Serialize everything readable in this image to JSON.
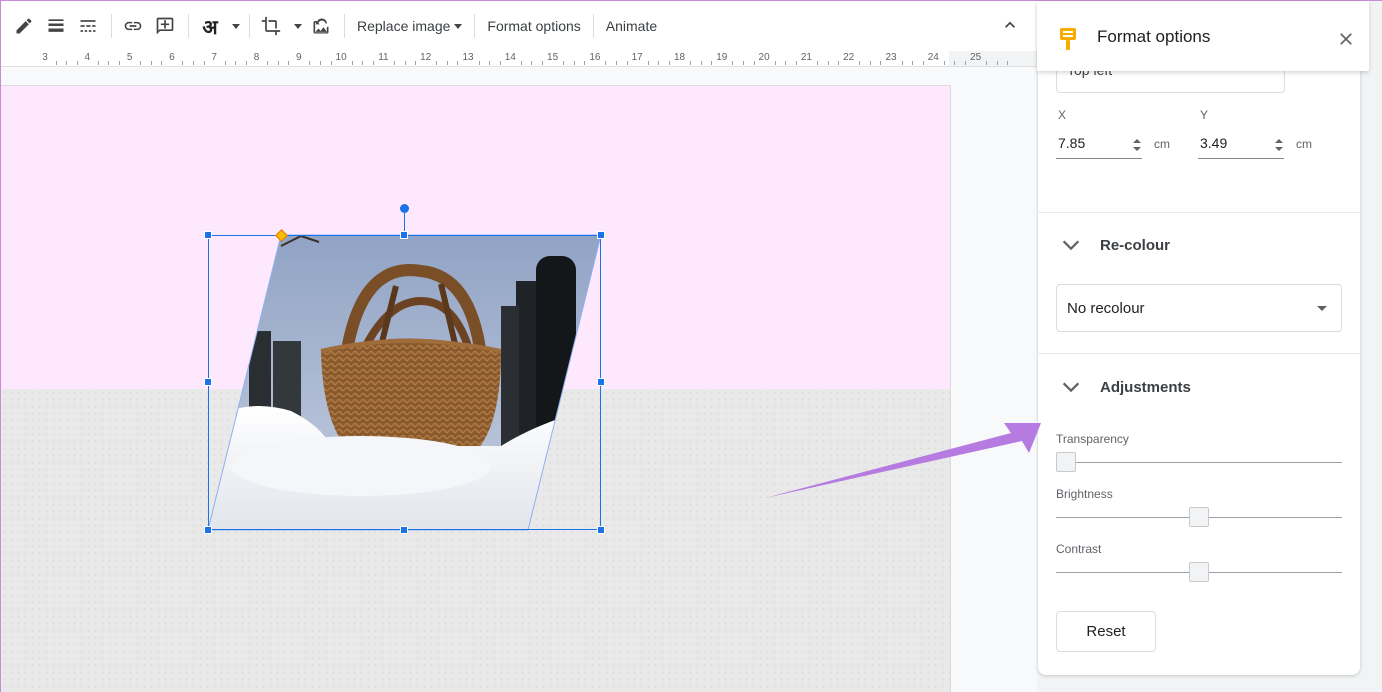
{
  "toolbar": {
    "hindi_input": "अ",
    "replace_image": "Replace image",
    "format_options": "Format options",
    "animate": "Animate"
  },
  "ruler": {
    "labels": [
      "3",
      "4",
      "5",
      "6",
      "7",
      "8",
      "9",
      "10",
      "11",
      "12",
      "13",
      "14",
      "15",
      "16",
      "17",
      "18",
      "19",
      "20",
      "21",
      "22",
      "23",
      "24",
      "25"
    ]
  },
  "panel": {
    "title": "Format options",
    "position_select": "Top left",
    "x_label": "X",
    "x_value": "7.85",
    "x_unit": "cm",
    "y_label": "Y",
    "y_value": "3.49",
    "y_unit": "cm",
    "recolour": {
      "title": "Re-colour",
      "value": "No recolour"
    },
    "adjustments": {
      "title": "Adjustments",
      "transparency_label": "Transparency",
      "transparency": 0,
      "brightness_label": "Brightness",
      "brightness": 0.5,
      "contrast_label": "Contrast",
      "contrast": 0.5
    },
    "reset_label": "Reset"
  },
  "colors": {
    "accent": "#1a73e8",
    "slide_top": "#fde8fd",
    "annotation_arrow": "#b57be0",
    "brush_icon": "#f9ab00"
  }
}
